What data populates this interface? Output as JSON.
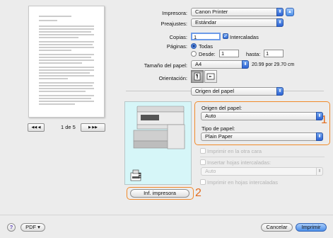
{
  "printer": {
    "label": "Impresora:",
    "value": "Canon Printer"
  },
  "presets": {
    "label": "Preajustes:",
    "value": "Estándar"
  },
  "copies": {
    "label": "Copias:",
    "value": "1",
    "collate_label": "Intercaladas"
  },
  "pages": {
    "label": "Páginas:",
    "all_label": "Todas",
    "from_label": "Desde:",
    "from_value": "1",
    "to_label": "hasta:",
    "to_value": "1"
  },
  "paper_size": {
    "label": "Tamaño del papel:",
    "value": "A4",
    "dimensions": "20.99 por 29.70 cm"
  },
  "orientation": {
    "label": "Orientación:"
  },
  "section": {
    "value": "Origen del papel"
  },
  "paper_source": {
    "label": "Origen del papel:",
    "value": "Auto"
  },
  "paper_type": {
    "label": "Tipo de papel:",
    "value": "Plain Paper"
  },
  "options": {
    "duplex_label": "Imprimir en la otra cara",
    "insert_sheets_label": "Insertar hojas intercaladas:",
    "insert_sheets_value": "Auto",
    "print_on_sheets_label": "Imprimir en hojas intercaladas"
  },
  "printer_info_button": "Inf. impresora",
  "preview": {
    "page_indicator": "1 de 5"
  },
  "callouts": {
    "one": "1",
    "two": "2"
  },
  "footer": {
    "help": "?",
    "pdf": "PDF ▾",
    "cancel": "Cancelar",
    "print": "Imprimir"
  },
  "icons": {
    "popup_arrows": "⬍",
    "nav_prev": "◀◀ ◀",
    "nav_next": "▶ ▶▶"
  }
}
